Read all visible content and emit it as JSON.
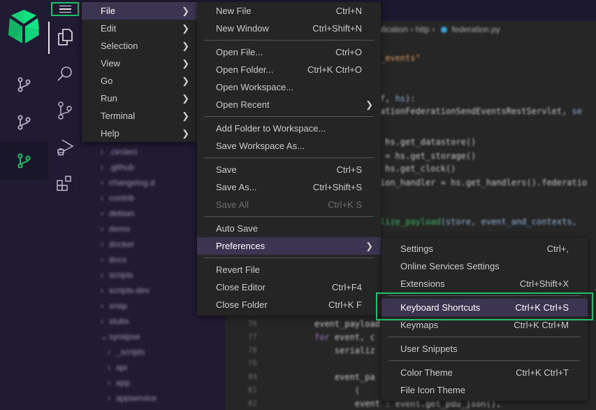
{
  "colors": {
    "accent": "#1fc16b",
    "menu_bg": "#252526",
    "menu_highlight": "#3c3552",
    "sidebar_bg": "#201a33",
    "editor_bg": "#262626"
  },
  "app_rail": {
    "logo": "cube-logo",
    "items": [
      {
        "icon": "git-branch-icon",
        "active": false
      },
      {
        "icon": "git-branch-icon",
        "active": false
      },
      {
        "icon": "git-branch-icon",
        "active": true
      }
    ]
  },
  "activity_bar": {
    "menu_button": "hamburger-menu-icon",
    "items": [
      {
        "icon": "files-icon",
        "label": "Explorer",
        "active": true
      },
      {
        "icon": "search-icon",
        "label": "Search"
      },
      {
        "icon": "source-control-icon",
        "label": "Source Control"
      },
      {
        "icon": "run-debug-icon",
        "label": "Run and Debug"
      },
      {
        "icon": "extensions-icon",
        "label": "Extensions"
      }
    ]
  },
  "explorer": {
    "items": [
      {
        "label": ".circleci",
        "expanded": false,
        "depth": 0
      },
      {
        "label": ".github",
        "expanded": false,
        "depth": 0
      },
      {
        "label": "changelog.d",
        "expanded": false,
        "depth": 0
      },
      {
        "label": "contrib",
        "expanded": false,
        "depth": 0
      },
      {
        "label": "debian",
        "expanded": false,
        "depth": 0
      },
      {
        "label": "demo",
        "expanded": false,
        "depth": 0
      },
      {
        "label": "docker",
        "expanded": false,
        "depth": 0
      },
      {
        "label": "docs",
        "expanded": false,
        "depth": 0
      },
      {
        "label": "scripts",
        "expanded": false,
        "depth": 0
      },
      {
        "label": "scripts-dev",
        "expanded": false,
        "depth": 0
      },
      {
        "label": "snap",
        "expanded": false,
        "depth": 0
      },
      {
        "label": "stubs",
        "expanded": false,
        "depth": 0
      },
      {
        "label": "synapse",
        "expanded": true,
        "depth": 0
      },
      {
        "label": "_scripts",
        "expanded": false,
        "depth": 1
      },
      {
        "label": "api",
        "expanded": false,
        "depth": 1
      },
      {
        "label": "app",
        "expanded": false,
        "depth": 1
      },
      {
        "label": "appservice",
        "expanded": false,
        "depth": 1
      }
    ]
  },
  "editor": {
    "breadcrumb": [
      "plication",
      "http",
      "federation.py"
    ],
    "code_lines": [
      {
        "parts": [
          {
            "t": "_events\"",
            "c": "c-str"
          }
        ]
      },
      {
        "parts": [
          {
            "t": "f, ",
            "c": ""
          },
          {
            "t": "hs",
            "c": "c-var"
          },
          {
            "t": "):",
            "c": ""
          }
        ]
      },
      {
        "parts": [
          {
            "t": "ationFederationSendEventsRestServlet, ",
            "c": ""
          },
          {
            "t": "se",
            "c": "c-var"
          }
        ]
      },
      {
        "parts": [
          {
            "t": " hs.get_datastore()",
            "c": ""
          }
        ]
      },
      {
        "parts": [
          {
            "t": " = hs.get_storage()",
            "c": ""
          }
        ]
      },
      {
        "parts": [
          {
            "t": " hs.get_clock()",
            "c": ""
          }
        ]
      },
      {
        "parts": [
          {
            "t": "ion_handler = hs.get_handlers().federatio",
            "c": ""
          }
        ]
      },
      {
        "parts": [
          {
            "t": "lize_payload",
            "c": "c-fn"
          },
          {
            "t": "(store, event_and_contexts, ",
            "c": "c-var"
          }
        ]
      }
    ],
    "lower_lines": [
      {
        "num": "76",
        "text": "event_payload"
      },
      {
        "num": "77",
        "kw": "for",
        "text": " event, c"
      },
      {
        "num": "78",
        "text": "    serializ"
      },
      {
        "num": "79",
        "text": ""
      },
      {
        "num": "80",
        "text": "    event_pa"
      },
      {
        "num": "81",
        "text": "        ("
      },
      {
        "num": "82",
        "text": "        event : event.get_pdu_json(),"
      }
    ]
  },
  "menubar": {
    "items": [
      {
        "label": "File",
        "highlighted": true
      },
      {
        "label": "Edit"
      },
      {
        "label": "Selection"
      },
      {
        "label": "View"
      },
      {
        "label": "Go"
      },
      {
        "label": "Run"
      },
      {
        "label": "Terminal"
      },
      {
        "label": "Help"
      }
    ]
  },
  "file_menu": {
    "groups": [
      [
        {
          "label": "New File",
          "shortcut": "Ctrl+N"
        },
        {
          "label": "New Window",
          "shortcut": "Ctrl+Shift+N"
        }
      ],
      [
        {
          "label": "Open File...",
          "shortcut": "Ctrl+O"
        },
        {
          "label": "Open Folder...",
          "shortcut": "Ctrl+K Ctrl+O"
        },
        {
          "label": "Open Workspace...",
          "shortcut": ""
        },
        {
          "label": "Open Recent",
          "shortcut": "",
          "submenu": true
        }
      ],
      [
        {
          "label": "Add Folder to Workspace...",
          "shortcut": ""
        },
        {
          "label": "Save Workspace As...",
          "shortcut": ""
        }
      ],
      [
        {
          "label": "Save",
          "shortcut": "Ctrl+S"
        },
        {
          "label": "Save As...",
          "shortcut": "Ctrl+Shift+S"
        },
        {
          "label": "Save All",
          "shortcut": "Ctrl+K S",
          "disabled": true
        }
      ],
      [
        {
          "label": "Auto Save",
          "shortcut": ""
        },
        {
          "label": "Preferences",
          "shortcut": "",
          "submenu": true,
          "highlighted": true
        }
      ],
      [
        {
          "label": "Revert File",
          "shortcut": ""
        },
        {
          "label": "Close Editor",
          "shortcut": "Ctrl+F4"
        },
        {
          "label": "Close Folder",
          "shortcut": "Ctrl+K F"
        }
      ]
    ]
  },
  "preferences_menu": {
    "groups": [
      [
        {
          "label": "Settings",
          "shortcut": "Ctrl+,"
        },
        {
          "label": "Online Services Settings",
          "shortcut": ""
        },
        {
          "label": "Extensions",
          "shortcut": "Ctrl+Shift+X"
        }
      ],
      [
        {
          "label": "Keyboard Shortcuts",
          "shortcut": "Ctrl+K Ctrl+S",
          "highlighted": true
        },
        {
          "label": "Keymaps",
          "shortcut": "Ctrl+K Ctrl+M"
        }
      ],
      [
        {
          "label": "User Snippets",
          "shortcut": ""
        }
      ],
      [
        {
          "label": "Color Theme",
          "shortcut": "Ctrl+K Ctrl+T"
        },
        {
          "label": "File Icon Theme",
          "shortcut": ""
        }
      ]
    ]
  }
}
